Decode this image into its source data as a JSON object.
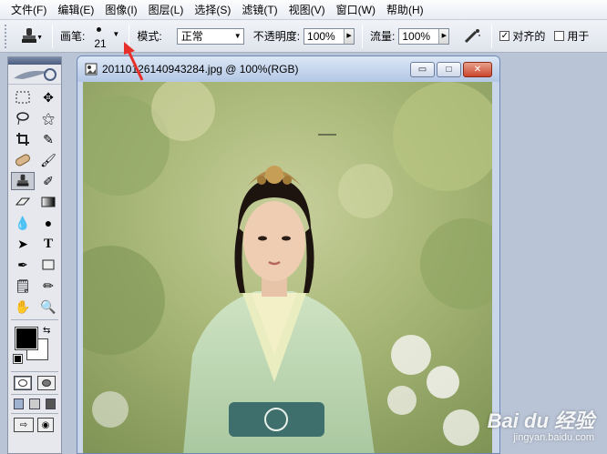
{
  "menu": [
    "文件(F)",
    "编辑(E)",
    "图像(I)",
    "图层(L)",
    "选择(S)",
    "滤镜(T)",
    "视图(V)",
    "窗口(W)",
    "帮助(H)"
  ],
  "options": {
    "brush_label": "画笔:",
    "brush_size": "21",
    "mode_label": "模式:",
    "mode_value": "正常",
    "opacity_label": "不透明度:",
    "opacity_value": "100%",
    "flow_label": "流量:",
    "flow_value": "100%",
    "aligned_label": "对齐的",
    "aligned_checked": true,
    "sample_all_label": "用于",
    "sample_all_checked": false
  },
  "document": {
    "title": "20110126140943284.jpg @ 100%(RGB)",
    "minimize_symbol": "▭",
    "maximize_symbol": "□",
    "close_symbol": "✕"
  },
  "watermark": {
    "logo": "Bai du 经验",
    "url": "jingyan.baidu.com"
  },
  "colors": {
    "foreground": "#000000",
    "background": "#ffffff",
    "annotation_arrow": "#e8302a"
  }
}
